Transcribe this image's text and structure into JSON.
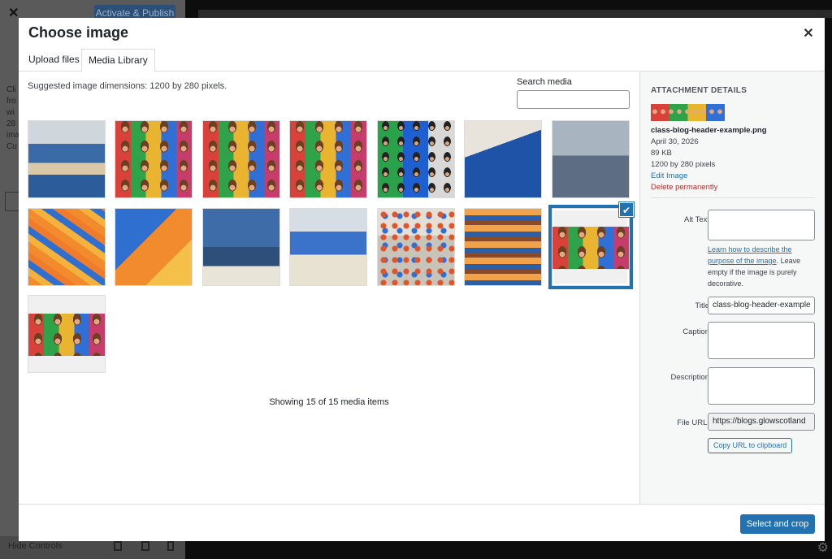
{
  "background": {
    "publish_label": "Activate & Publish",
    "side_text": "Cli fro wi 28 ima Cu",
    "hide_controls": "Hide Controls"
  },
  "modal": {
    "title": "Choose image",
    "tabs": [
      {
        "label": "Upload files",
        "active": false
      },
      {
        "label": "Media Library",
        "active": true
      }
    ],
    "suggested": "Suggested image dimensions: 1200 by 280 pixels.",
    "search": {
      "label": "Search media",
      "placeholder": "",
      "value": ""
    },
    "showing": "Showing 15 of 15 media items",
    "select_button": "Select and crop"
  },
  "attachment": {
    "heading": "ATTACHMENT DETAILS",
    "filename": "class-blog-header-example.png",
    "date": "April 30, 2026",
    "size": "89 KB",
    "dimensions": "1200 by 280 pixels",
    "edit_link": "Edit Image",
    "delete_link": "Delete permanently",
    "alt_text_label": "Alt Text",
    "alt_text_value": "",
    "help_link": "Learn how to describe the purpose of the image",
    "help_text": ". Leave empty if the image is purely decorative.",
    "title_label": "Title",
    "title_value": "class-blog-header-example",
    "caption_label": "Caption",
    "caption_value": "",
    "description_label": "Description",
    "description_value": "",
    "file_url_label": "File URL:",
    "file_url_value": "https://blogs.glowscotland",
    "copy_button": "Copy URL to clipboard"
  },
  "colors": {
    "accent": "#2271b1",
    "delete": "#b32d2e"
  }
}
